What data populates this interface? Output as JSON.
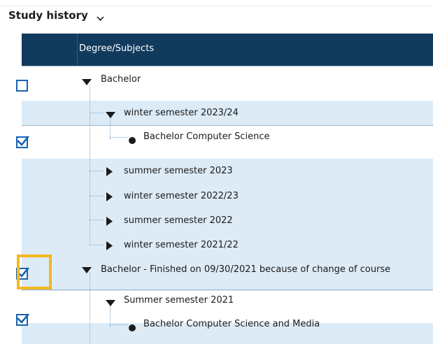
{
  "section": {
    "title": "Study history"
  },
  "table": {
    "header": "Degree/Subjects"
  },
  "tree": {
    "degree1": "Bachelor",
    "d1_sem1": "winter semester 2023/24",
    "d1_sem1_subject": "Bachelor Computer Science",
    "d1_sem2": "summer semester 2023",
    "d1_sem3": "winter semester 2022/23",
    "d1_sem4": "summer semester 2022",
    "d1_sem5": "winter semester 2021/22",
    "degree2": "Bachelor - Finished on 09/30/2021 because of change of course",
    "d2_sem1": "Summer semester 2021",
    "d2_sem1_subject": "Bachelor Computer Science and Media"
  },
  "checkboxes": {
    "degree1": false,
    "d1_sem1_subject": true,
    "degree2": true,
    "d2_sem1_subject": true
  },
  "colors": {
    "header_bg": "#113a5d",
    "band_bg": "#dcebf6",
    "check_blue": "#1663b0",
    "focus_highlight": "#f5b820"
  }
}
